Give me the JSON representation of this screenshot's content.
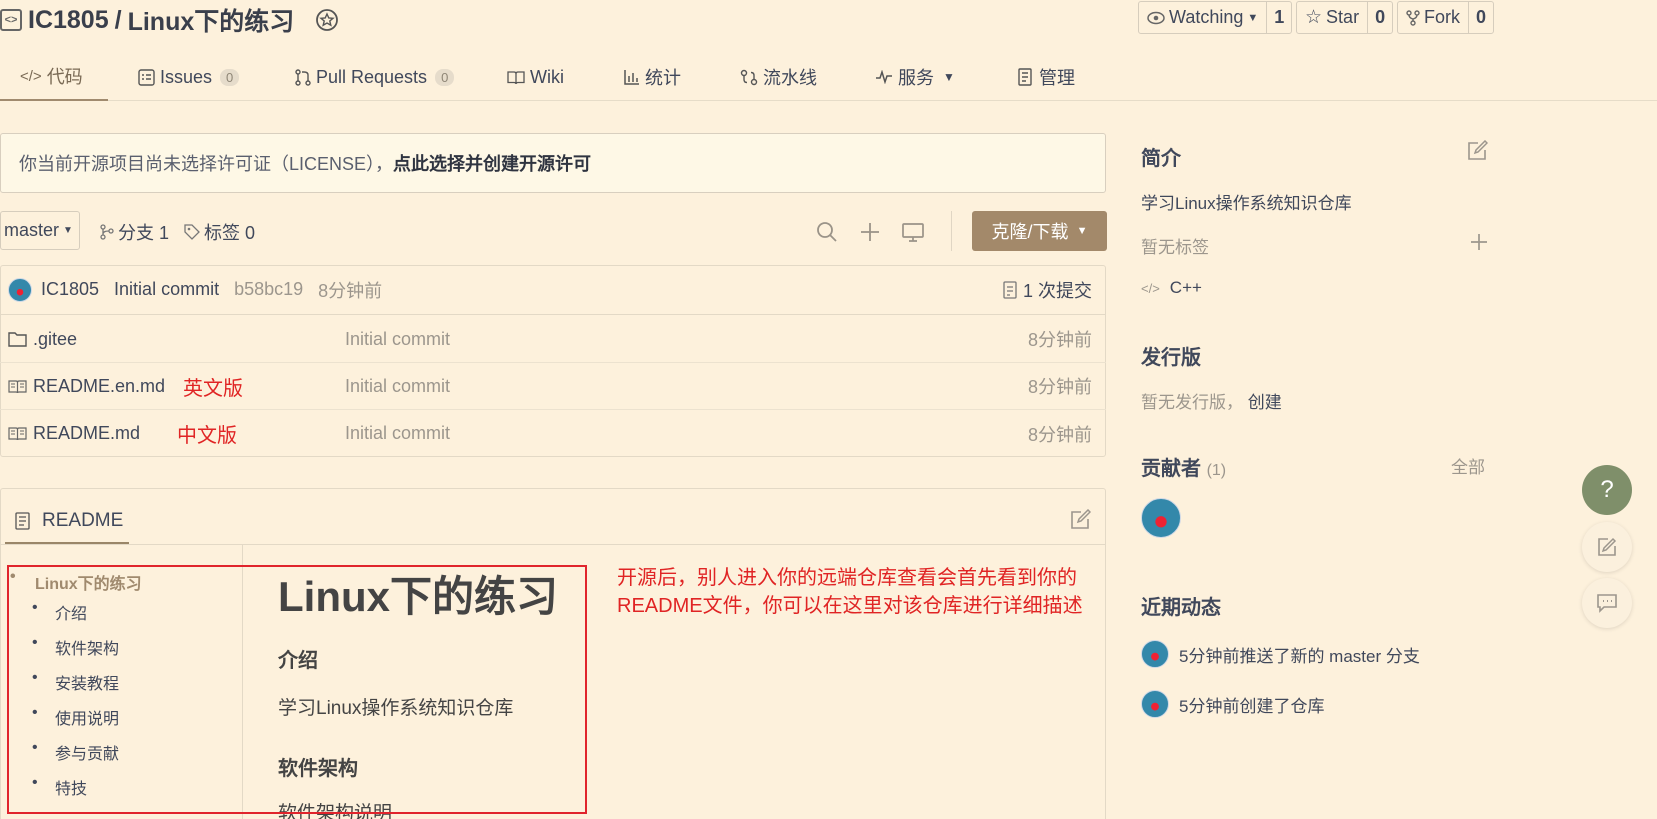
{
  "repo": {
    "owner": "IC1805",
    "separator": "/",
    "name": "Linux下的练习"
  },
  "actions": {
    "watching_label": "Watching",
    "watching_count": "1",
    "star_label": "Star",
    "star_count": "0",
    "fork_label": "Fork",
    "fork_count": "0"
  },
  "tabs": [
    {
      "label": "代码",
      "icon": "code-icon"
    },
    {
      "label": "Issues",
      "count": "0",
      "icon": "issues-icon"
    },
    {
      "label": "Pull Requests",
      "count": "0",
      "icon": "pull-request-icon"
    },
    {
      "label": "Wiki",
      "icon": "book-icon"
    },
    {
      "label": "统计",
      "icon": "chart-icon"
    },
    {
      "label": "流水线",
      "icon": "pipeline-icon"
    },
    {
      "label": "服务",
      "icon": "pulse-icon"
    },
    {
      "label": "管理",
      "icon": "manage-icon"
    }
  ],
  "license": {
    "text": "你当前开源项目尚未选择许可证（LICENSE），",
    "link": "点此选择并创建开源许可"
  },
  "branch": {
    "current": "master",
    "branches_label": "分支 1",
    "tags_label": "标签 0",
    "clone_label": "克隆/下载"
  },
  "commit": {
    "author": "IC1805",
    "message": "Initial commit",
    "hash": "b58bc19",
    "time": "8分钟前",
    "count_label": "1 次提交"
  },
  "files": [
    {
      "name": ".gitee",
      "type": "folder",
      "message": "Initial commit",
      "time": "8分钟前",
      "note": ""
    },
    {
      "name": "README.en.md",
      "type": "file",
      "message": "Initial commit",
      "time": "8分钟前",
      "note": "英文版"
    },
    {
      "name": "README.md",
      "type": "file",
      "message": "Initial commit",
      "time": "8分钟前",
      "note": "中文版"
    }
  ],
  "readme": {
    "tab_label": "README",
    "toc_title": "Linux下的练习",
    "toc_items": [
      "介绍",
      "软件架构",
      "安装教程",
      "使用说明",
      "参与贡献",
      "特技"
    ],
    "title": "Linux下的练习",
    "intro_heading": "介绍",
    "intro_text": "学习Linux操作系统知识仓库",
    "arch_heading": "软件架构",
    "arch_text": "软件架构说明",
    "annotation_line1": "开源后，别人进入你的远端仓库查看会首先看到你的",
    "annotation_line2": "README文件，你可以在这里对该仓库进行详细描述"
  },
  "sidebar": {
    "intro_heading": "简介",
    "intro_text": "学习Linux操作系统知识仓库",
    "no_tags": "暂无标签",
    "language": "C++",
    "release_heading": "发行版",
    "no_release": "暂无发行版，",
    "create_link": "创建",
    "contributors_heading": "贡献者",
    "contributors_count": "(1)",
    "contributors_all": "全部",
    "activity_heading": "近期动态",
    "activities": [
      "5分钟前推送了新的 master 分支",
      "5分钟前创建了仓库"
    ]
  },
  "fab": {
    "help_label": "?"
  }
}
